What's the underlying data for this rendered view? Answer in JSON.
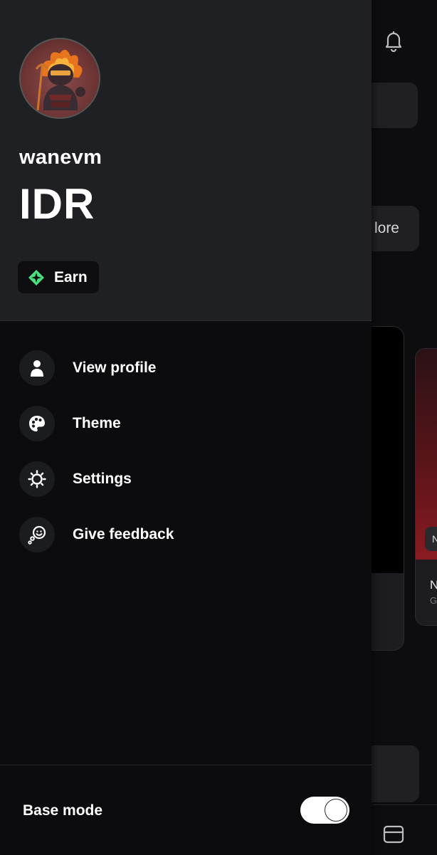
{
  "background": {
    "more_button_label": "lore",
    "tile_tag": "N",
    "tile_title": "N",
    "tile_subtitle": "G"
  },
  "profile": {
    "username": "wanevm",
    "currency": "IDR",
    "earn_label": "Earn"
  },
  "menu": {
    "items": [
      {
        "label": "View profile",
        "icon": "person-icon"
      },
      {
        "label": "Theme",
        "icon": "palette-icon"
      },
      {
        "label": "Settings",
        "icon": "gear-icon"
      },
      {
        "label": "Give feedback",
        "icon": "feedback-icon"
      }
    ]
  },
  "footer": {
    "base_mode_label": "Base mode",
    "base_mode_enabled": true
  },
  "colors": {
    "drawer_header": "#1f2024",
    "drawer_body": "#0c0c0e",
    "earn_accent": "#4ade80"
  }
}
